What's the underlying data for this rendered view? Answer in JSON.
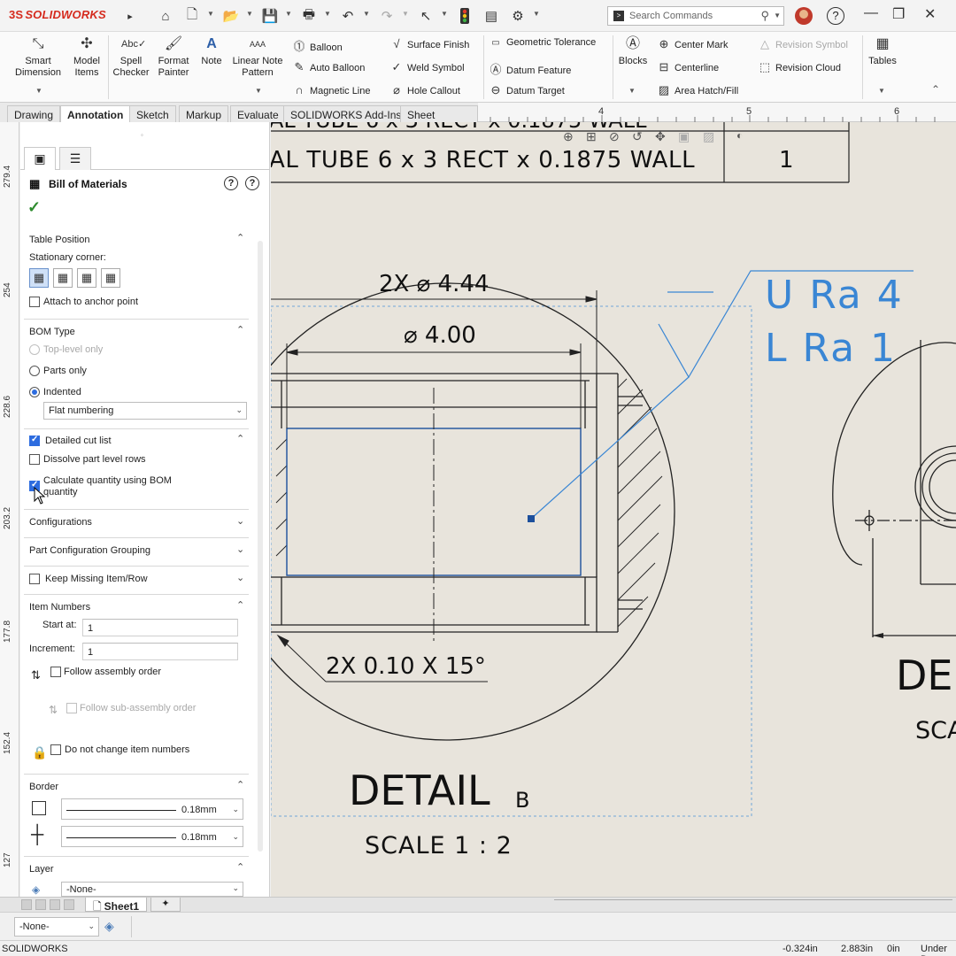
{
  "app": {
    "brand": "SOLIDWORKS",
    "search_placeholder": "Search Commands"
  },
  "ribbon": {
    "smart_dimension": "Smart Dimension",
    "model_items": "Model Items",
    "spell_checker": "Spell Checker",
    "format_painter": "Format Painter",
    "note": "Note",
    "linear_note_pattern": "Linear Note Pattern",
    "balloon": "Balloon",
    "auto_balloon": "Auto Balloon",
    "magnetic_line": "Magnetic Line",
    "surface_finish": "Surface Finish",
    "weld_symbol": "Weld Symbol",
    "hole_callout": "Hole Callout",
    "geometric_tolerance": "Geometric Tolerance",
    "datum_feature": "Datum Feature",
    "datum_target": "Datum Target",
    "blocks": "Blocks",
    "center_mark": "Center Mark",
    "centerline": "Centerline",
    "area_hatch": "Area Hatch/Fill",
    "revision_symbol": "Revision Symbol",
    "revision_cloud": "Revision Cloud",
    "tables": "Tables"
  },
  "tabs": [
    "Drawing",
    "Annotation",
    "Sketch",
    "Markup",
    "Evaluate",
    "SOLIDWORKS Add-Ins",
    "Sheet Format"
  ],
  "ruler": {
    "h_ticks": [
      "4",
      "5",
      "6"
    ],
    "v_ticks": [
      "279.4",
      "254",
      "228.6",
      "203.2",
      "177.8",
      "152.4",
      "127"
    ]
  },
  "panel": {
    "title": "Bill of Materials",
    "table_position": {
      "header": "Table Position",
      "stationary_corner": "Stationary corner:",
      "attach_anchor": "Attach to anchor point"
    },
    "bom_type": {
      "header": "BOM Type",
      "top_level": "Top-level only",
      "parts_only": "Parts only",
      "indented": "Indented",
      "numbering": "Flat numbering"
    },
    "cut_list": {
      "header": "Detailed cut list",
      "dissolve": "Dissolve part level rows",
      "calc_qty": "Calculate quantity using BOM quantity"
    },
    "configurations": "Configurations",
    "part_config_grouping": "Part Configuration Grouping",
    "keep_missing": "Keep Missing Item/Row",
    "item_numbers": {
      "header": "Item Numbers",
      "start_at_label": "Start at:",
      "start_at": "1",
      "increment_label": "Increment:",
      "increment": "1",
      "follow_assembly": "Follow assembly order",
      "follow_sub": "Follow sub-assembly order",
      "do_not_change": "Do not change item numbers"
    },
    "border": {
      "header": "Border",
      "box_thickness": "0.18mm",
      "grid_thickness": "0.18mm"
    },
    "layer": {
      "header": "Layer",
      "value": "-None-"
    }
  },
  "drawing": {
    "bom_row_top": "AL TUBE 6 x 3 RECT x 0.1875 WALL",
    "bom_row_top_qty": "1",
    "bom_row": "AL TUBE 6 x 3 RECT x 0.1875 WALL",
    "bom_qty": "1",
    "dim_outer": "2X ⌀ 4.44",
    "dim_inner": "⌀ 4.00",
    "chamfer": "2X 0.10 X 15°",
    "finish_upper": "U Ra 4",
    "finish_lower": "L Ra 1",
    "detail_title": "DETAIL",
    "detail_letter": "B",
    "scale": "SCALE 1 : 2",
    "detail2_title": "DE",
    "detail2_scale": "SCA"
  },
  "sheets": {
    "active": "Sheet1"
  },
  "layerbar": {
    "value": "-None-"
  },
  "status": {
    "app": "SOLIDWORKS",
    "x": "-0.324in",
    "y": "2.883in",
    "z": "0in",
    "state": "Under D"
  },
  "colors": {
    "canvas": "#e8e4dc",
    "accent": "#2d6cdf",
    "annotation": "#3a86d4",
    "brand": "#d52b1e"
  }
}
